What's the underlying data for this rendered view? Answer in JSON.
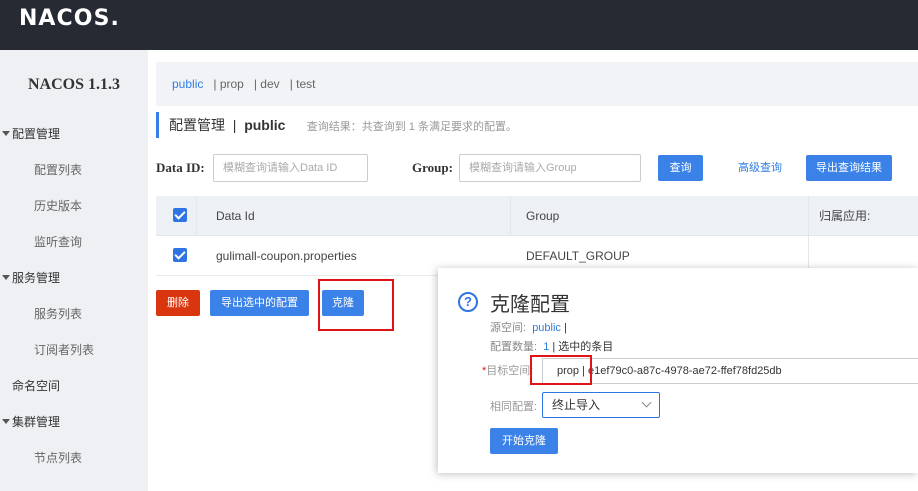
{
  "topbar": {
    "logo_prefix": "NA",
    "logo_mid": "C",
    "logo_o": "O",
    "logo_suffix": "S."
  },
  "sidebar": {
    "title": "NACOS 1.1.3",
    "items": [
      {
        "label": "配置管理",
        "type": "group"
      },
      {
        "label": "配置列表",
        "type": "child"
      },
      {
        "label": "历史版本",
        "type": "child"
      },
      {
        "label": "监听查询",
        "type": "child"
      },
      {
        "label": "服务管理",
        "type": "group"
      },
      {
        "label": "服务列表",
        "type": "child"
      },
      {
        "label": "订阅者列表",
        "type": "child"
      },
      {
        "label": "命名空间",
        "type": "plain"
      },
      {
        "label": "集群管理",
        "type": "group"
      },
      {
        "label": "节点列表",
        "type": "child"
      }
    ]
  },
  "namespaces": {
    "items": [
      "public",
      "| prop",
      "| dev",
      "| test"
    ]
  },
  "page_title": {
    "main": "配置管理",
    "sep": "|",
    "ns": "public",
    "hint": "查询结果：共查询到 1 条满足要求的配置。"
  },
  "search": {
    "dataid_label": "Data ID:",
    "dataid_placeholder": "模糊查询请输入Data ID",
    "group_label": "Group:",
    "group_placeholder": "模糊查询请输入Group",
    "query_button": "查询",
    "advanced_button": "高级查询",
    "export_button": "导出查询结果"
  },
  "table": {
    "headers": [
      "Data Id",
      "Group",
      "归属应用:"
    ],
    "rows": [
      {
        "data_id": "gulimall-coupon.properties",
        "group": "DEFAULT_GROUP",
        "app": ""
      }
    ]
  },
  "actions": {
    "delete": "删除",
    "export_selected": "导出选中的配置",
    "clone": "克隆"
  },
  "dialog": {
    "title": "克隆配置",
    "source_label": "源空间:",
    "source_value": "public",
    "source_suffix": "|",
    "count_label": "配置数量:",
    "count_value": "1",
    "count_suffix": "| 选中的条目",
    "target_label": "目标空间:",
    "target_value": "prop | e1ef79c0-a87c-4978-ae72-ffef78fd25db",
    "same_label": "相同配置:",
    "same_value": "终止导入",
    "start_button": "开始克隆"
  }
}
